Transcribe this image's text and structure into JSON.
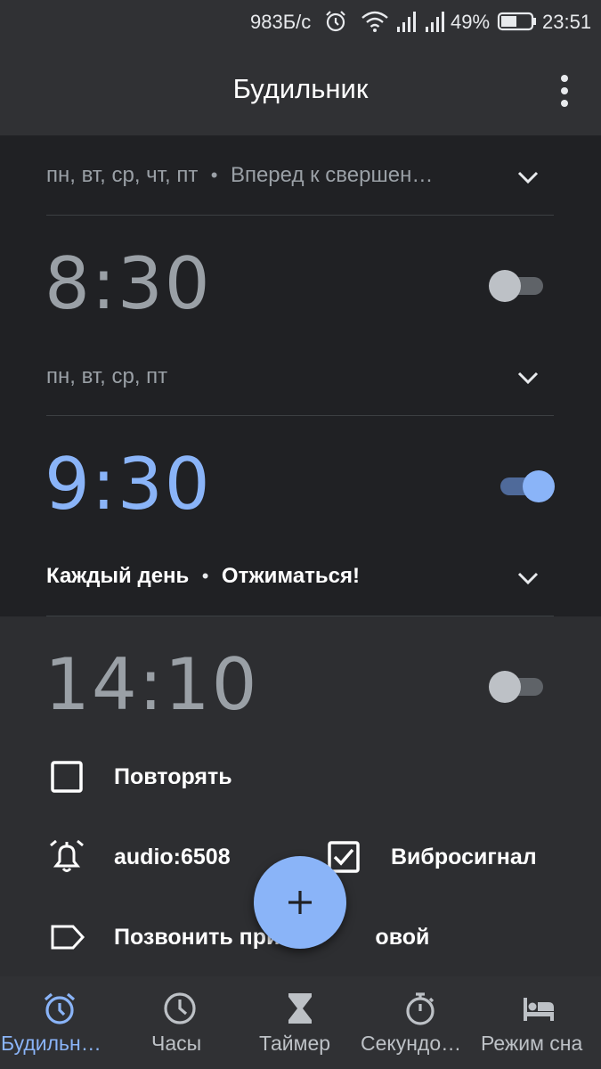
{
  "status_bar": {
    "speed": "983Б/с",
    "battery": "49%",
    "time": "23:51"
  },
  "app_bar": {
    "title": "Будильник",
    "menu_icon": "more-vert-icon"
  },
  "alarms": [
    {
      "days": "пн, вт, ср, чт, пт",
      "label": "Вперед к свершен…"
    },
    {
      "time": "8:30",
      "enabled": false,
      "days": "пн, вт, ср, пт"
    },
    {
      "time": "9:30",
      "enabled": true,
      "days": "Каждый день",
      "label": "Отжиматься!"
    },
    {
      "time": "14:10",
      "enabled": false,
      "options": {
        "repeat_label": "Повторять",
        "repeat_checked": false,
        "ringtone": "audio:6508",
        "vibrate_label": "Вибросигнал",
        "vibrate_checked": true,
        "label_text": "Позвонить при",
        "label_text_tail": "овой"
      }
    }
  ],
  "fab": {
    "icon": "plus-icon"
  },
  "bottom_nav": {
    "items": [
      {
        "label": "Будильн…",
        "icon": "alarm-icon",
        "active": true
      },
      {
        "label": "Часы",
        "icon": "clock-icon",
        "active": false
      },
      {
        "label": "Таймер",
        "icon": "hourglass-icon",
        "active": false
      },
      {
        "label": "Секундо…",
        "icon": "stopwatch-icon",
        "active": false
      },
      {
        "label": "Режим сна",
        "icon": "bed-icon",
        "active": false
      }
    ]
  },
  "colors": {
    "background": "#202124",
    "surface": "#303134",
    "expanded": "#2d2e31",
    "accent": "#8ab4f8",
    "muted": "#9aa0a6"
  }
}
